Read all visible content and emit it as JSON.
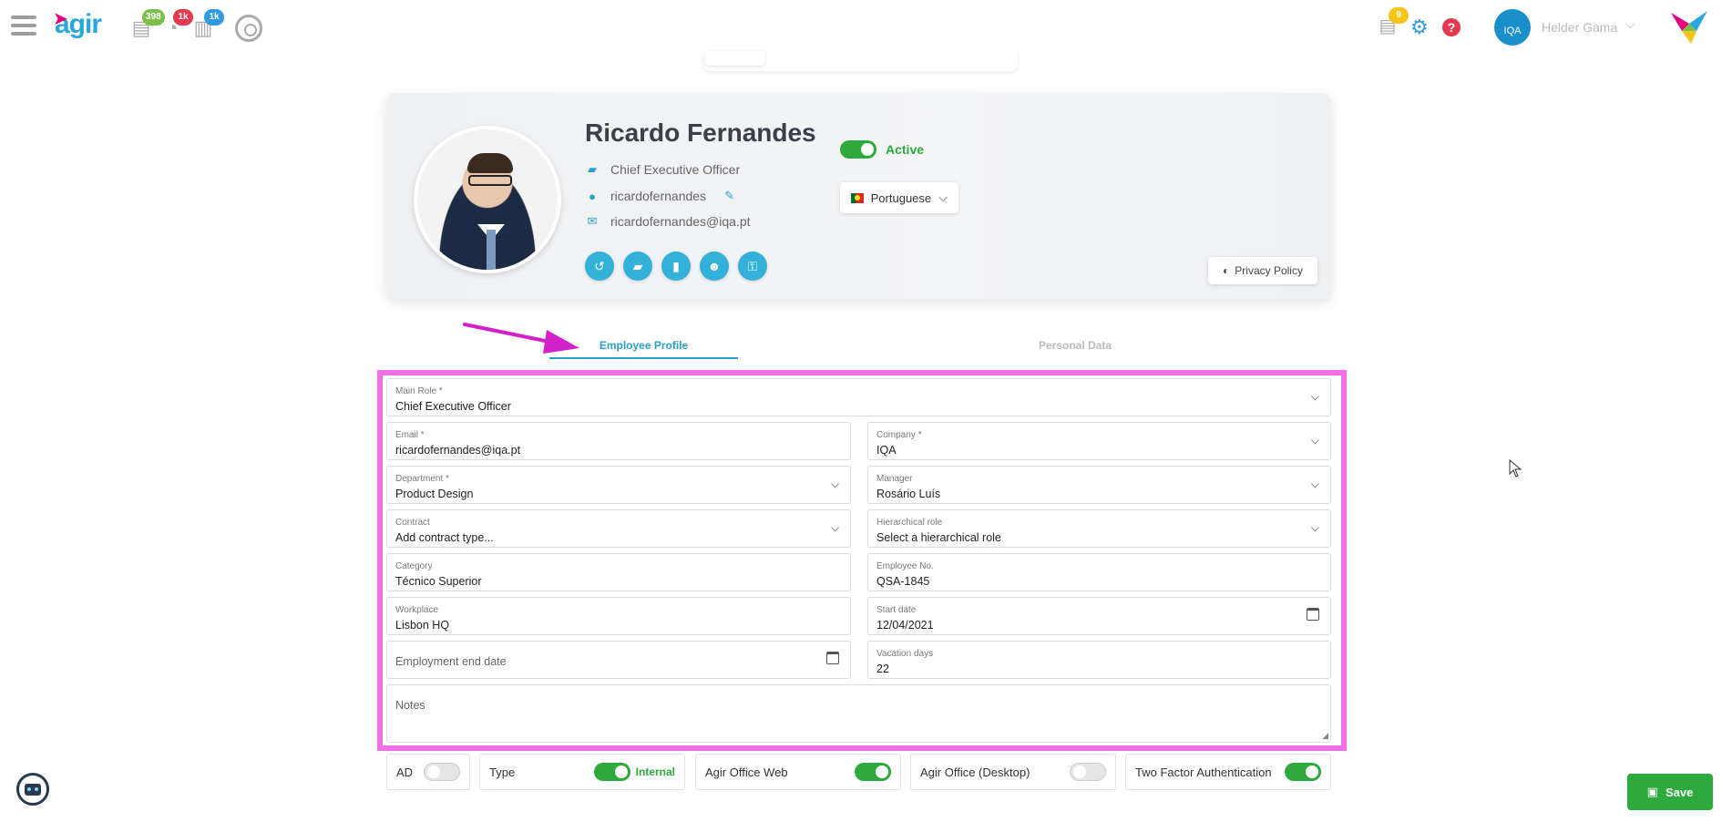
{
  "header": {
    "logo_text": "agir",
    "badges": {
      "tasks": "398",
      "clock": "1k",
      "docs": "1k",
      "notifications": "9"
    },
    "user_name": "Helder Gama",
    "org_logo_text": "IQA"
  },
  "profile": {
    "name": "Ricardo Fernandes",
    "job_title": "Chief Executive Officer",
    "username": "ricardofernandes",
    "email": "ricardofernandes@iqa.pt",
    "status_label": "Active",
    "language": "Portuguese",
    "privacy_label": "Privacy Policy"
  },
  "tabs": {
    "employee_profile": "Employee Profile",
    "personal_data": "Personal Data"
  },
  "form": {
    "main_role": {
      "label": "Main Role *",
      "value": "Chief Executive Officer"
    },
    "email": {
      "label": "Email *",
      "value": "ricardofernandes@iqa.pt"
    },
    "company": {
      "label": "Company *",
      "value": "IQA"
    },
    "department": {
      "label": "Department *",
      "value": "Product Design"
    },
    "manager": {
      "label": "Manager",
      "value": "Rosário Luís"
    },
    "contract": {
      "label": "Contract",
      "value": "Add contract type..."
    },
    "hierarchical_role": {
      "label": "Hierarchical role",
      "value": "Select a hierarchical role"
    },
    "category": {
      "label": "Category",
      "value": "Técnico Superior"
    },
    "employee_no": {
      "label": "Employee No.",
      "value": "QSA-1845"
    },
    "workplace": {
      "label": "Workplace",
      "value": "Lisbon HQ"
    },
    "start_date": {
      "label": "Start date",
      "value": "12/04/2021"
    },
    "end_date": {
      "placeholder": "Employment end date"
    },
    "vacation_days": {
      "label": "Vacation days",
      "value": "22"
    },
    "notes": {
      "placeholder": "Notes"
    }
  },
  "switches": {
    "ad": "AD",
    "type": "Type",
    "type_value": "Internal",
    "office_web": "Agir Office Web",
    "office_desktop": "Agir Office (Desktop)",
    "two_factor": "Two Factor Authentication"
  },
  "save_label": "Save",
  "colors": {
    "accent": "#2aa0c8",
    "success": "#2eaa3c",
    "highlight": "#f06ee6",
    "danger": "#e53950"
  }
}
